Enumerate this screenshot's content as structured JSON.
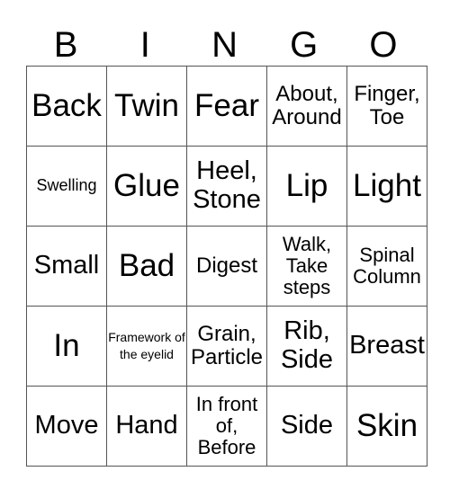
{
  "header": [
    "B",
    "I",
    "N",
    "G",
    "O"
  ],
  "rows": [
    [
      "Back",
      "Twin",
      "Fear",
      "About, Around",
      "Finger, Toe"
    ],
    [
      "Swelling",
      "Glue",
      "Heel, Stone",
      "Lip",
      "Light"
    ],
    [
      "Small",
      "Bad",
      "Digest",
      "Walk, Take steps",
      "Spinal Column"
    ],
    [
      "In",
      "Framework of the eyelid",
      "Grain, Particle",
      "Rib, Side",
      "Breast"
    ],
    [
      "Move",
      "Hand",
      "In front of, Before",
      "Side",
      "Skin"
    ]
  ]
}
